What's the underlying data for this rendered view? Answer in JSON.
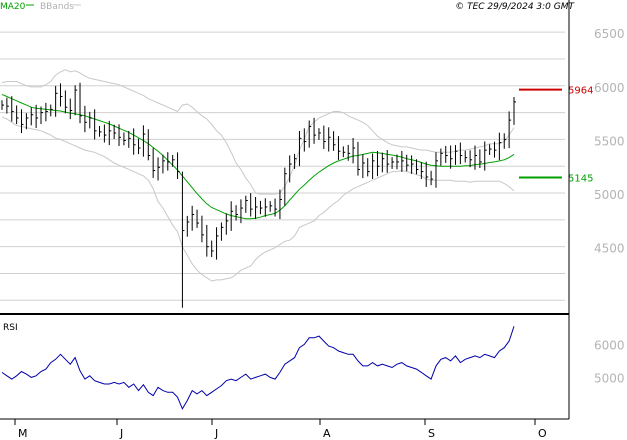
{
  "chart_data": {
    "type": "candlestick",
    "legend": {
      "ma_label": "MA20",
      "bb_label": "BBands"
    },
    "timestamp": "© TEC 29/9/2024 3:0 GMT",
    "price_axis": {
      "min": 3900,
      "max": 6800,
      "ticks": [
        {
          "value": 4500,
          "label": "4500"
        },
        {
          "value": 5000,
          "label": "5000"
        },
        {
          "value": 5500,
          "label": "5500"
        },
        {
          "value": 6000,
          "label": "6000"
        },
        {
          "value": 6500,
          "label": "6500"
        }
      ]
    },
    "markers": [
      {
        "label": "5964",
        "value": 5964,
        "color": "#cc0000"
      },
      {
        "label": "5145",
        "value": 5145,
        "color": "#00a000"
      }
    ],
    "rsi": {
      "label": "RSI",
      "min": 3800,
      "max": 6800,
      "ticks": [
        {
          "value": 6000,
          "label": "6000"
        },
        {
          "value": 5000,
          "label": "5000"
        }
      ]
    },
    "x_ticks": [
      "M",
      "J",
      "J",
      "A",
      "S",
      "O"
    ],
    "colors": {
      "ma": "#00a000",
      "bands": "#c8c8c8",
      "price": "#000000",
      "rsi": "#0000aa",
      "grid": "#d0d0d0",
      "axis_text": "#b4b4b4"
    },
    "series_close": [
      5820,
      5810,
      5760,
      5700,
      5640,
      5700,
      5730,
      5700,
      5750,
      5760,
      5780,
      5930,
      5900,
      5800,
      5770,
      5960,
      5720,
      5660,
      5700,
      5580,
      5570,
      5540,
      5580,
      5560,
      5520,
      5490,
      5510,
      5450,
      5420,
      5550,
      5350,
      5210,
      5240,
      5300,
      5290,
      5310,
      5200,
      4650,
      4730,
      4800,
      4720,
      4610,
      4500,
      4460,
      4600,
      4680,
      4740,
      4830,
      4800,
      4860,
      4930,
      4850,
      4870,
      4860,
      4870,
      4880,
      4850,
      4940,
      5180,
      5270,
      5320,
      5510,
      5480,
      5620,
      5540,
      5560,
      5480,
      5520,
      5450,
      5390,
      5380,
      5370,
      5420,
      5220,
      5280,
      5200,
      5300,
      5250,
      5320,
      5270,
      5290,
      5290,
      5300,
      5260,
      5270,
      5220,
      5200,
      5150,
      5130,
      5300,
      5370,
      5350,
      5320,
      5390,
      5350,
      5330,
      5310,
      5350,
      5290,
      5400,
      5410,
      5400,
      5470,
      5500,
      5680,
      5850
    ],
    "series_ma20": [
      5920,
      5900,
      5880,
      5860,
      5840,
      5820,
      5800,
      5790,
      5785,
      5780,
      5775,
      5770,
      5765,
      5755,
      5745,
      5738,
      5730,
      5720,
      5705,
      5690,
      5675,
      5660,
      5645,
      5625,
      5605,
      5585,
      5565,
      5540,
      5515,
      5490,
      5460,
      5425,
      5390,
      5350,
      5305,
      5260,
      5215,
      5160,
      5105,
      5050,
      4995,
      4945,
      4900,
      4865,
      4845,
      4825,
      4805,
      4790,
      4780,
      4770,
      4760,
      4760,
      4765,
      4775,
      4790,
      4800,
      4810,
      4840,
      4880,
      4935,
      4985,
      5035,
      5075,
      5120,
      5160,
      5195,
      5225,
      5255,
      5280,
      5300,
      5315,
      5330,
      5345,
      5350,
      5360,
      5370,
      5380,
      5375,
      5370,
      5360,
      5355,
      5345,
      5335,
      5320,
      5310,
      5300,
      5285,
      5270,
      5260,
      5255,
      5250,
      5250,
      5250,
      5250,
      5250,
      5255,
      5255,
      5265,
      5270,
      5275,
      5285,
      5290,
      5300,
      5310,
      5330,
      5360
    ],
    "series_bb_upper": [
      6030,
      6040,
      6040,
      6040,
      6020,
      6000,
      5990,
      5990,
      5990,
      6010,
      6040,
      6100,
      6130,
      6150,
      6130,
      6140,
      6120,
      6090,
      6070,
      6060,
      6050,
      6040,
      6030,
      6020,
      6010,
      5990,
      5970,
      5950,
      5930,
      5910,
      5880,
      5860,
      5840,
      5820,
      5800,
      5780,
      5760,
      5820,
      5830,
      5800,
      5760,
      5720,
      5690,
      5640,
      5580,
      5540,
      5470,
      5380,
      5280,
      5220,
      5140,
      5080,
      5000,
      4990,
      4990,
      4990,
      4990,
      5000,
      5060,
      5150,
      5260,
      5400,
      5500,
      5620,
      5660,
      5700,
      5720,
      5740,
      5760,
      5760,
      5750,
      5720,
      5700,
      5680,
      5660,
      5630,
      5580,
      5530,
      5500,
      5470,
      5450,
      5440,
      5430,
      5430,
      5420,
      5410,
      5400,
      5400,
      5390,
      5380,
      5380,
      5380,
      5380,
      5390,
      5400,
      5400,
      5410,
      5420,
      5430,
      5440,
      5460,
      5460,
      5460,
      5480,
      5540,
      5610
    ],
    "series_bb_lower": [
      5710,
      5690,
      5660,
      5630,
      5620,
      5610,
      5600,
      5590,
      5580,
      5560,
      5540,
      5510,
      5500,
      5480,
      5460,
      5440,
      5420,
      5400,
      5390,
      5380,
      5360,
      5340,
      5310,
      5280,
      5260,
      5240,
      5220,
      5200,
      5180,
      5160,
      5120,
      5040,
      4920,
      4860,
      4780,
      4700,
      4640,
      4500,
      4420,
      4340,
      4280,
      4240,
      4210,
      4180,
      4190,
      4190,
      4200,
      4210,
      4240,
      4280,
      4300,
      4320,
      4380,
      4420,
      4450,
      4470,
      4490,
      4520,
      4550,
      4560,
      4600,
      4680,
      4700,
      4720,
      4740,
      4790,
      4820,
      4860,
      4900,
      4930,
      4980,
      5010,
      5040,
      5060,
      5080,
      5100,
      5120,
      5140,
      5160,
      5180,
      5200,
      5200,
      5210,
      5200,
      5190,
      5170,
      5160,
      5130,
      5120,
      5120,
      5120,
      5120,
      5120,
      5110,
      5110,
      5110,
      5100,
      5110,
      5110,
      5110,
      5110,
      5110,
      5110,
      5090,
      5060,
      5020
    ],
    "series_rsi": [
      5150,
      5050,
      4950,
      5050,
      5180,
      5100,
      5000,
      5050,
      5180,
      5250,
      5450,
      5550,
      5700,
      5550,
      5400,
      5600,
      5200,
      4950,
      5050,
      4900,
      4850,
      4800,
      4800,
      4850,
      4800,
      4850,
      4700,
      4800,
      4600,
      4780,
      4550,
      4450,
      4700,
      4600,
      4550,
      4550,
      4400,
      4050,
      4300,
      4600,
      4500,
      4600,
      4450,
      4550,
      4650,
      4750,
      4900,
      4950,
      4900,
      5000,
      5100,
      4950,
      5000,
      5050,
      5100,
      5000,
      4950,
      5150,
      5400,
      5500,
      5600,
      5900,
      6000,
      6200,
      6200,
      6250,
      6100,
      5950,
      5900,
      5800,
      5750,
      5700,
      5700,
      5500,
      5350,
      5350,
      5450,
      5350,
      5400,
      5350,
      5300,
      5400,
      5450,
      5350,
      5300,
      5250,
      5150,
      5050,
      4950,
      5350,
      5550,
      5600,
      5500,
      5650,
      5450,
      5550,
      5600,
      5650,
      5600,
      5700,
      5650,
      5600,
      5800,
      5900,
      6100,
      6550
    ]
  }
}
